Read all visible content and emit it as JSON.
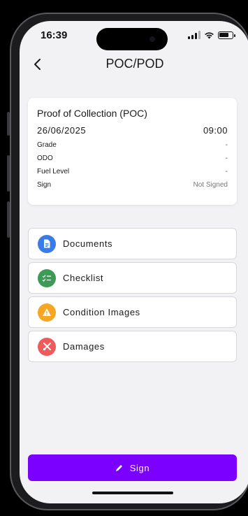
{
  "status_bar": {
    "time": "16:39",
    "battery_level": 0.75
  },
  "header": {
    "title": "POC/POD"
  },
  "poc_card": {
    "title": "Proof of Collection (POC)",
    "date": "26/06/2025",
    "time": "09:00",
    "rows": [
      {
        "label": "Grade",
        "value": "-"
      },
      {
        "label": "ODO",
        "value": "-"
      },
      {
        "label": "Fuel Level",
        "value": "-"
      },
      {
        "label": "Sign",
        "value": "Not Signed"
      }
    ]
  },
  "menu": [
    {
      "label": "Documents",
      "icon": "document-icon",
      "color": "#3b7be8"
    },
    {
      "label": "Checklist",
      "icon": "checklist-icon",
      "color": "#3d9a57"
    },
    {
      "label": "Condition Images",
      "icon": "warning-icon",
      "color": "#f5a623"
    },
    {
      "label": "Damages",
      "icon": "tools-icon",
      "color": "#ef5b5b"
    }
  ],
  "sign_button": {
    "label": "Sign",
    "color": "#7b00ff",
    "icon": "pen-icon"
  }
}
